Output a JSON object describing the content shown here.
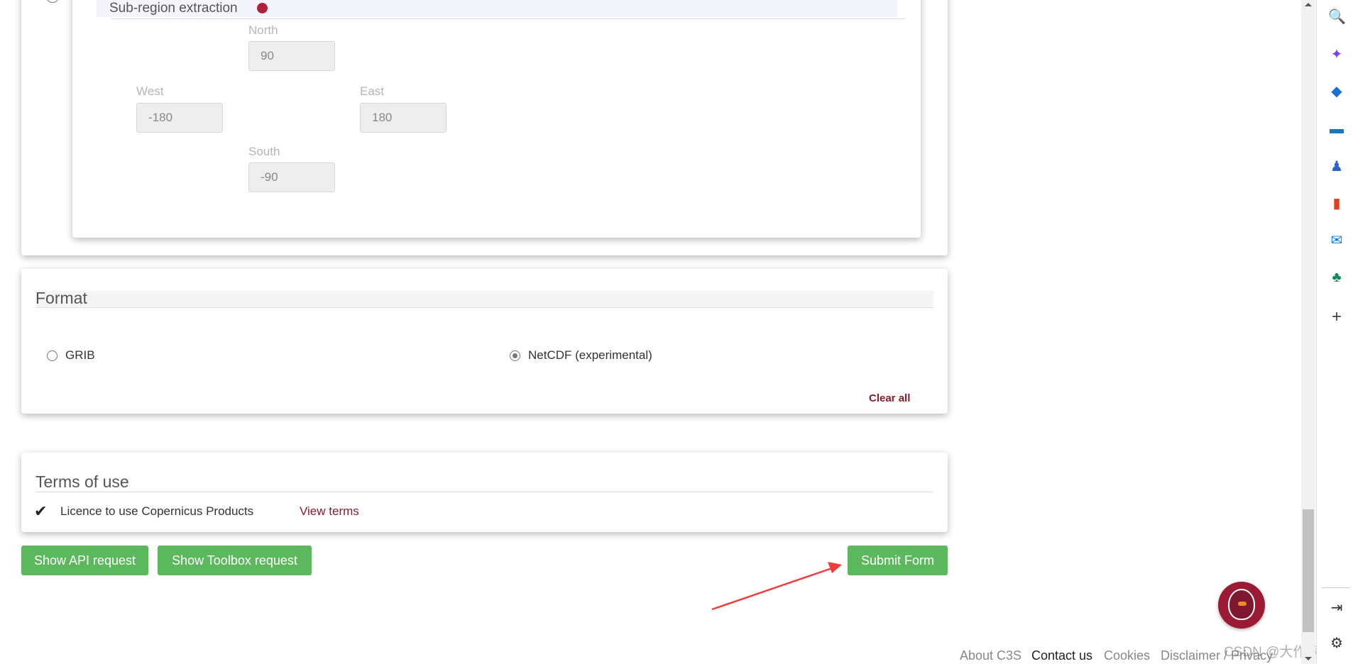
{
  "subregion": {
    "title": "Sub-region extraction",
    "north_label": "North",
    "north": "90",
    "west_label": "West",
    "west": "-180",
    "east_label": "East",
    "east": "180",
    "south_label": "South",
    "south": "-90"
  },
  "format": {
    "title": "Format",
    "options": [
      {
        "label": "GRIB",
        "selected": false
      },
      {
        "label": "NetCDF (experimental)",
        "selected": true
      }
    ],
    "clear_all": "Clear all"
  },
  "terms": {
    "title": "Terms of use",
    "licence": "Licence to use Copernicus Products",
    "view_terms": "View terms"
  },
  "buttons": {
    "api": "Show API request",
    "toolbox": "Show Toolbox request",
    "submit": "Submit Form"
  },
  "footer": [
    "About C3S",
    "Contact us",
    "Cookies",
    "Disclaimer / Privacy"
  ],
  "watermark": "CSDN @大作家佚名",
  "sidebar_icons": [
    "search-icon",
    "copilot-icon",
    "shopping-tag-icon",
    "tools-icon",
    "games-icon",
    "office-icon",
    "outlook-icon",
    "tree-icon",
    "add-icon"
  ],
  "colors": {
    "button": "#5cb85c",
    "link": "#8b1a2b",
    "annotation_arrow": "#f03c3c"
  }
}
